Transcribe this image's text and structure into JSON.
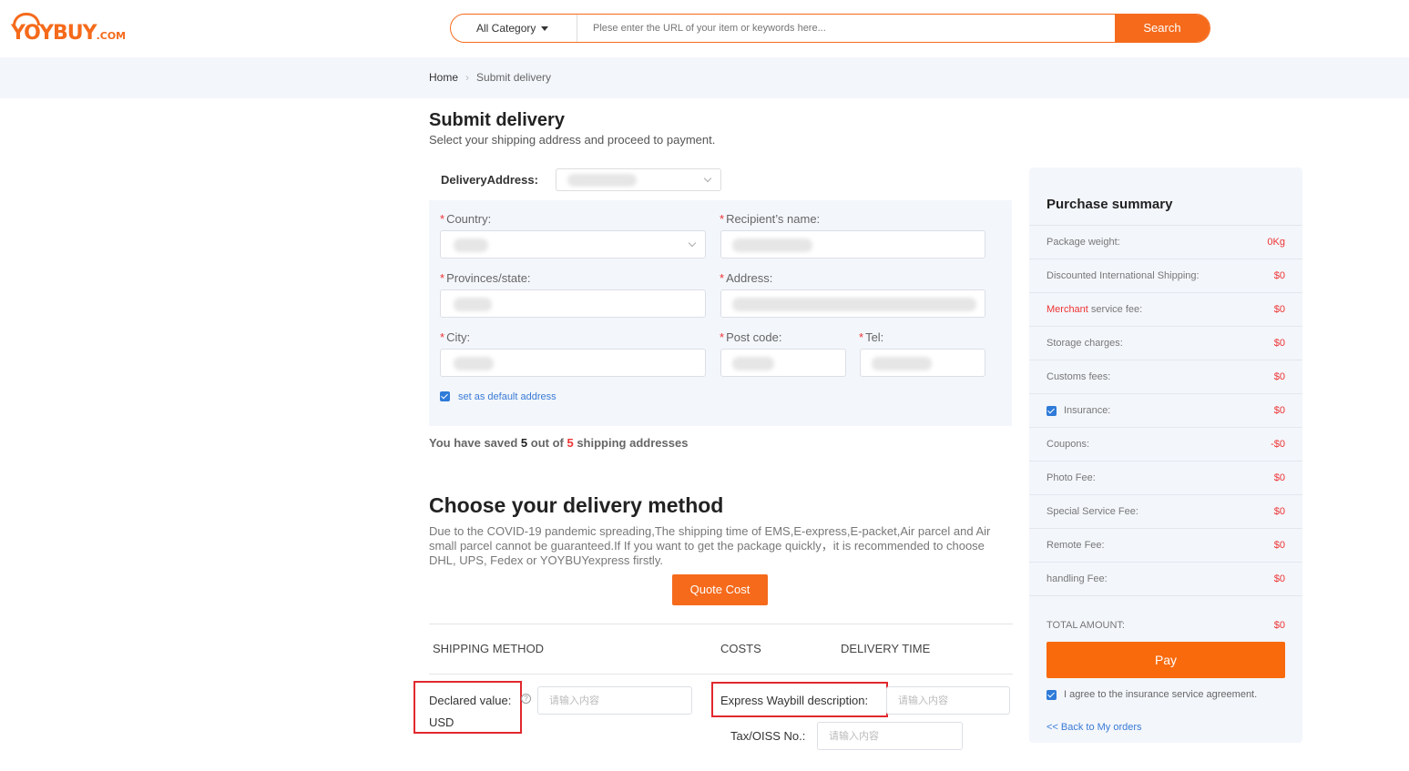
{
  "header": {
    "logo_main": "YOYBUY",
    "logo_suffix": ".COM",
    "category_label": "All Category",
    "search_placeholder": "Plese enter the URL of your item or keywords here...",
    "search_button": "Search"
  },
  "breadcrumb": {
    "home": "Home",
    "current": "Submit delivery"
  },
  "page": {
    "title": "Submit delivery",
    "subtitle": "Select your shipping address and proceed to payment."
  },
  "address": {
    "delivery_label": "DeliveryAddress:",
    "country_label": "Country:",
    "recipient_label": "Recipient’s name:",
    "province_label": "Provinces/state:",
    "address_label": "Address:",
    "city_label": "City:",
    "postcode_label": "Post code:",
    "tel_label": "Tel:",
    "required_mark": "*",
    "default_label": "set as default address",
    "saved_prefix": "You have saved ",
    "saved_count": "5",
    "saved_mid": " out of ",
    "saved_max": "5",
    "saved_suffix": " shipping addresses"
  },
  "delivery": {
    "title": "Choose your delivery method",
    "description": "Due to the COVID-19 pandemic spreading,The shipping time of EMS,E-express,E-packet,Air parcel and Air small parcel cannot be guaranteed.If If you want to get the package quickly，it is recommended to choose DHL, UPS, Fedex or YOYBUYexpress firstly.",
    "quote_button": "Quote Cost",
    "col_method": "SHIPPING METHOD",
    "col_costs": "COSTS",
    "col_time": "DELIVERY TIME",
    "declared_label": "Declared value:",
    "declared_unit": "USD",
    "help_icon": "?",
    "declared_placeholder": "请输入内容",
    "waybill_label": "Express Waybill description:",
    "waybill_placeholder": "请输入内容",
    "tax_label": "Tax/OISS No.:",
    "tax_placeholder": "请输入内容"
  },
  "summary": {
    "title": "Purchase summary",
    "rows": [
      {
        "label": "Package weight:",
        "value": "0Kg"
      },
      {
        "label": "Discounted International Shipping:",
        "value": "$0"
      },
      {
        "label_highlight": "Merchant",
        "label": " service fee:",
        "value": "$0"
      },
      {
        "label": "Storage charges:",
        "value": "$0"
      },
      {
        "label": "Customs fees:",
        "value": "$0"
      },
      {
        "label": "Insurance:",
        "value": "$0"
      },
      {
        "label": "Coupons:",
        "value": "-$0"
      },
      {
        "label": "Photo Fee:",
        "value": "$0"
      },
      {
        "label": "Special Service Fee:",
        "value": "$0"
      },
      {
        "label": "Remote Fee:",
        "value": "$0"
      },
      {
        "label": "handling Fee:",
        "value": "$0"
      }
    ],
    "total_label": "TOTAL AMOUNT:",
    "total_value": "$0",
    "pay_button": "Pay",
    "agree_label": "I agree to the insurance service agreement.",
    "back_link": "<< Back to My orders"
  },
  "colors": {
    "accent": "#f56a1b",
    "price": "#e33333",
    "link": "#3a7bd5",
    "panel": "#f3f6fb",
    "highlight_box": "#e0282e"
  }
}
